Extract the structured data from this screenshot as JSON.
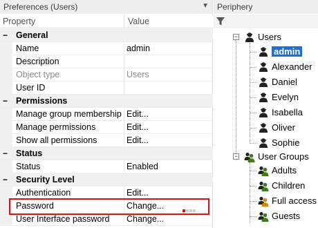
{
  "left_panel": {
    "title": "Preferences (Users)",
    "pin_icon": "pin-icon",
    "columns": {
      "property": "Property",
      "value": "Value"
    },
    "rows": [
      {
        "type": "group",
        "label": "General",
        "toggle": "−"
      },
      {
        "type": "item",
        "label": "Name",
        "value": "admin"
      },
      {
        "type": "item",
        "label": "Description",
        "value": ""
      },
      {
        "type": "item",
        "label": "Object type",
        "value": "Users",
        "disabled": true
      },
      {
        "type": "item",
        "label": "User ID",
        "value": ""
      },
      {
        "type": "group",
        "label": "Permissions",
        "toggle": "−"
      },
      {
        "type": "item",
        "label": "Manage group membership",
        "value": "Edit..."
      },
      {
        "type": "item",
        "label": "Manage permissions",
        "value": "Edit..."
      },
      {
        "type": "item",
        "label": "Show all permissions",
        "value": "Edit..."
      },
      {
        "type": "group",
        "label": "Status",
        "toggle": "−"
      },
      {
        "type": "item",
        "label": "Status",
        "value": "Enabled"
      },
      {
        "type": "group",
        "label": "Security Level",
        "toggle": "−"
      },
      {
        "type": "item",
        "label": "Authentication",
        "value": "Edit..."
      },
      {
        "type": "item",
        "label": "Password",
        "value": "Change..."
      },
      {
        "type": "item",
        "label": "User Interface password",
        "value": "Change..."
      }
    ]
  },
  "right_panel": {
    "title": "Periphery",
    "filter_icon": "filter-icon",
    "users_group": {
      "label": "Users",
      "expander": "−"
    },
    "users": [
      {
        "name": "admin",
        "selected": true
      },
      {
        "name": "Alexander"
      },
      {
        "name": "Daniel"
      },
      {
        "name": "Evelyn"
      },
      {
        "name": "Isabella"
      },
      {
        "name": "Oliver"
      },
      {
        "name": "Sophie"
      }
    ],
    "user_groups": {
      "label": "User Groups",
      "expander": "−"
    },
    "groups": [
      {
        "name": "Adults",
        "icon_color": "#3d7d12"
      },
      {
        "name": "Children",
        "icon_color": "#3d7d12"
      },
      {
        "name": "Full access",
        "icon_color": "#d68a00"
      },
      {
        "name": "Guests",
        "icon_color": "#3d7d12"
      }
    ]
  },
  "colors": {
    "highlight": "#e01010",
    "selection": "#1e6fd8"
  }
}
